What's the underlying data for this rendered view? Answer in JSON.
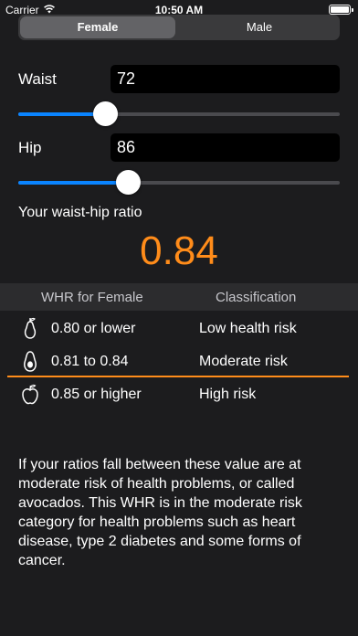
{
  "status": {
    "carrier": "Carrier",
    "time": "10:50 AM"
  },
  "segments": {
    "female": "Female",
    "male": "Male",
    "selected": "female"
  },
  "waist": {
    "label": "Waist",
    "value": "72",
    "slider_fraction": 0.27
  },
  "hip": {
    "label": "Hip",
    "value": "86",
    "slider_fraction": 0.34
  },
  "ratio": {
    "title": "Your waist-hip ratio",
    "value": "0.84"
  },
  "table": {
    "header": {
      "col1": "WHR for Female",
      "col2": "Classification"
    },
    "rows": [
      {
        "icon": "pear-icon",
        "range": "0.80 or lower",
        "classification": "Low health risk"
      },
      {
        "icon": "avocado-icon",
        "range": "0.81 to 0.84",
        "classification": "Moderate risk",
        "highlighted": true
      },
      {
        "icon": "apple-icon",
        "range": "0.85 or higher",
        "classification": "High risk"
      }
    ]
  },
  "description": "If your ratios fall between these value are at moderate risk of health problems, or called avocados. This WHR is in the moderate risk category for health problems such as heart disease, type 2 diabetes and some forms of cancer.",
  "colors": {
    "accent": "#ff8c1a",
    "slider": "#0a84ff",
    "background": "#1c1c1e"
  }
}
